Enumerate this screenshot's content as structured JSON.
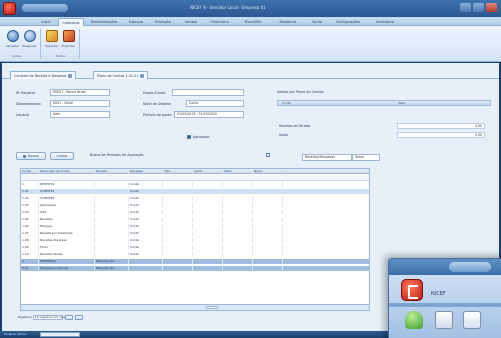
{
  "window": {
    "title": "NICEF 9 - Servidor Local - Empresa 01",
    "minimize_label": "",
    "maximize_label": "",
    "close_label": ""
  },
  "ribbon_tabs": [
    "Início",
    "Cadastros",
    "Movimentações",
    "Estoque",
    "Produção",
    "Vendas",
    "Financeiro",
    "Fiscal/NFe",
    "Relatórios",
    "Ajuda",
    "Configurações",
    "Assinatura"
  ],
  "ribbon_active_tab": "Cadastros",
  "ribbon": {
    "buttons": [
      {
        "label": "Atualizar",
        "icon": "refresh-icon"
      },
      {
        "label": "Pesquisar",
        "icon": "search-icon"
      },
      {
        "label": "Importar",
        "icon": "import-icon"
      },
      {
        "label": "Exportar",
        "icon": "export-icon"
      }
    ],
    "groups": [
      "Ações",
      "Dados"
    ]
  },
  "doc_tabs": [
    "Controle de Receita e Despesa",
    "Plano de Contas 1.01.01"
  ],
  "form": {
    "fields": [
      {
        "label": "Nº Registro",
        "value": "00001 - Banco Brasil"
      },
      {
        "label": "Departamento",
        "value": "0001 - Geral"
      },
      {
        "label": "Usuário",
        "value": "Adm"
      }
    ],
    "right_fields": [
      {
        "label": "Depto./Conta",
        "value": ""
      },
      {
        "label": "Nível de Detalhe",
        "value": "Conta"
      },
      {
        "label": "Período de gasto",
        "value": "01/03/2019  -  31/03/2019"
      }
    ],
    "checkbox_label": "Agrupado",
    "actions": {
      "search_label": "Buscar",
      "clear_label": "Limpar",
      "period_label": "Busca de Períodos de Apuração"
    }
  },
  "summary": {
    "title": "Saldos por Plano de Contas",
    "header_desc": "Conta",
    "header_value": "Valor",
    "rows": [
      {
        "label": "Receitas do Período",
        "value": "0,00"
      },
      {
        "label": "Saldo",
        "value": "0,00"
      }
    ],
    "dropdown": "Receitas/Despesas",
    "dropdown_value": "Todos"
  },
  "grid": {
    "columns": [
      "Conta",
      "Descrição da Conta",
      "Receita",
      "Despesa",
      "Tipo",
      "Saldo",
      "Valor",
      "Nível"
    ],
    "rows": [
      [
        "1",
        "RECEITAS",
        "",
        "Conta",
        "",
        "",
        "",
        ""
      ],
      [
        "1.01",
        "CLIENTES",
        "",
        "Conta",
        "",
        "",
        "",
        ""
      ],
      [
        "1.02",
        "CLIENTES",
        "",
        "Conta",
        "",
        "",
        "",
        ""
      ],
      [
        "1.03",
        "Aplicações",
        "",
        "Conta",
        "",
        "",
        "",
        ""
      ],
      [
        "1.04",
        "ISSF",
        "",
        "Conta",
        "",
        "",
        "",
        ""
      ],
      [
        "1.05",
        "Receitas",
        "",
        "Conta",
        "",
        "",
        "",
        ""
      ],
      [
        "1.06",
        "Estoque",
        "",
        "Conta",
        "",
        "",
        "",
        ""
      ],
      [
        "1.07",
        "Receita por Prestação",
        "",
        "Conta",
        "",
        "",
        "",
        ""
      ],
      [
        "1.08",
        "Receitas Diversas",
        "",
        "Conta",
        "",
        "",
        "",
        ""
      ],
      [
        "1.09",
        "Fluxo",
        "",
        "Conta",
        "",
        "",
        "",
        ""
      ],
      [
        "1.10",
        "Receitas Notas",
        "",
        "Conta",
        "",
        "",
        "",
        ""
      ],
      [
        "2",
        "DESPESAS",
        "Manutenção",
        "",
        "",
        "",
        "",
        ""
      ],
      [
        "2.01",
        "Despesas Diversas",
        "Manutenção",
        "",
        "",
        "",
        "",
        ""
      ]
    ],
    "selected_row": 1,
    "footer_value": "0,00"
  },
  "pager": {
    "label": "Registros",
    "per_page": "10 registros por pág."
  },
  "status": {
    "text": "Usuário: Admin"
  },
  "second_window": {
    "name": "NICEF"
  }
}
